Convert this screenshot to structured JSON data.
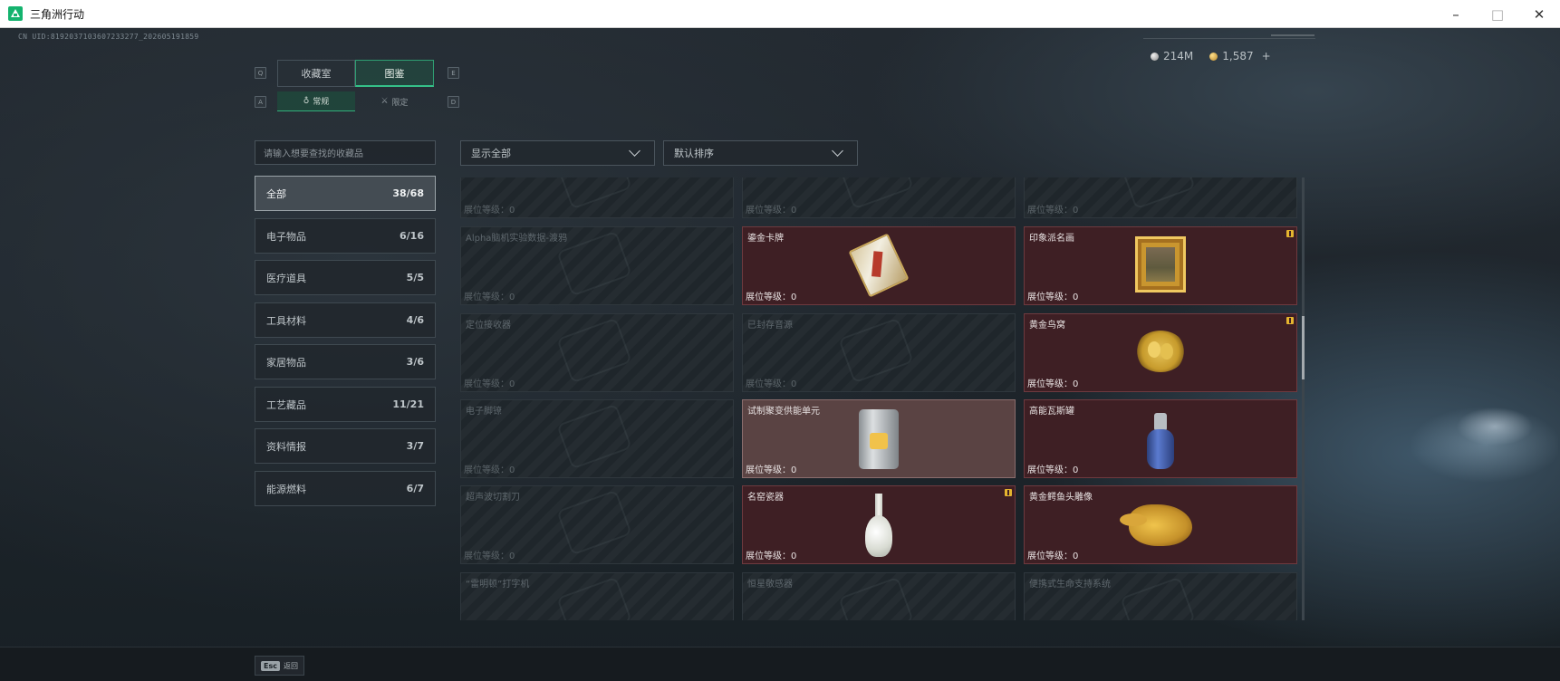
{
  "window": {
    "title": "三角洲行动",
    "controls": [
      "–",
      "□",
      "✕"
    ]
  },
  "uid": "CN UID:8192037103607233277_202605191859",
  "currency": {
    "silver": "214M",
    "gold": "1,587",
    "plus": "+"
  },
  "keys": {
    "left_tab": "Q",
    "right_tab": "E",
    "left_sub": "A",
    "right_sub": "D"
  },
  "tabs": {
    "collection_room": "收藏室",
    "codex": "图鉴"
  },
  "subtabs": {
    "normal": "常规",
    "limited": "限定"
  },
  "search": {
    "placeholder": "请输入想要查找的收藏品"
  },
  "filter": {
    "selected": "显示全部"
  },
  "sort": {
    "selected": "默认排序"
  },
  "categories": [
    {
      "name": "全部",
      "count": "38/68"
    },
    {
      "name": "电子物品",
      "count": "6/16"
    },
    {
      "name": "医疗道具",
      "count": "5/5"
    },
    {
      "name": "工具材料",
      "count": "4/6"
    },
    {
      "name": "家居物品",
      "count": "3/6"
    },
    {
      "name": "工艺藏品",
      "count": "11/21"
    },
    {
      "name": "资料情报",
      "count": "3/7"
    },
    {
      "name": "能源燃料",
      "count": "6/7"
    }
  ],
  "level_label": "展位等级：0",
  "items": [
    {
      "name": "",
      "owned": false
    },
    {
      "name": "",
      "owned": false
    },
    {
      "name": "",
      "owned": false
    },
    {
      "name": "Alpha脑机实验数据-渡鸦",
      "owned": false
    },
    {
      "name": "鎏金卡牌",
      "owned": true,
      "art": "tarot-card-icon"
    },
    {
      "name": "印象派名画",
      "owned": true,
      "art": "painting-frame-icon",
      "badge": true
    },
    {
      "name": "定位接收器",
      "owned": false
    },
    {
      "name": "已封存音源",
      "owned": false
    },
    {
      "name": "黄金鸟窝",
      "owned": true,
      "art": "golden-nest-icon",
      "badge": true
    },
    {
      "name": "电子脚镣",
      "owned": false
    },
    {
      "name": "试制聚变供能单元",
      "owned": true,
      "art": "fusion-unit-icon",
      "highlight": true
    },
    {
      "name": "高能瓦斯罐",
      "owned": true,
      "art": "gas-canister-icon"
    },
    {
      "name": "超声波切割刀",
      "owned": false
    },
    {
      "name": "名窑瓷器",
      "owned": true,
      "art": "porcelain-vase-icon",
      "badge": true
    },
    {
      "name": "黄金鳄鱼头雕像",
      "owned": true,
      "art": "golden-crocodile-icon"
    },
    {
      "name": "“雷明顿”打字机",
      "owned": false
    },
    {
      "name": "恒星敬感器",
      "owned": false
    },
    {
      "name": "便携式生命支持系统",
      "owned": false
    }
  ],
  "footer": {
    "esc_key": "Esc",
    "back_label": "返回"
  }
}
